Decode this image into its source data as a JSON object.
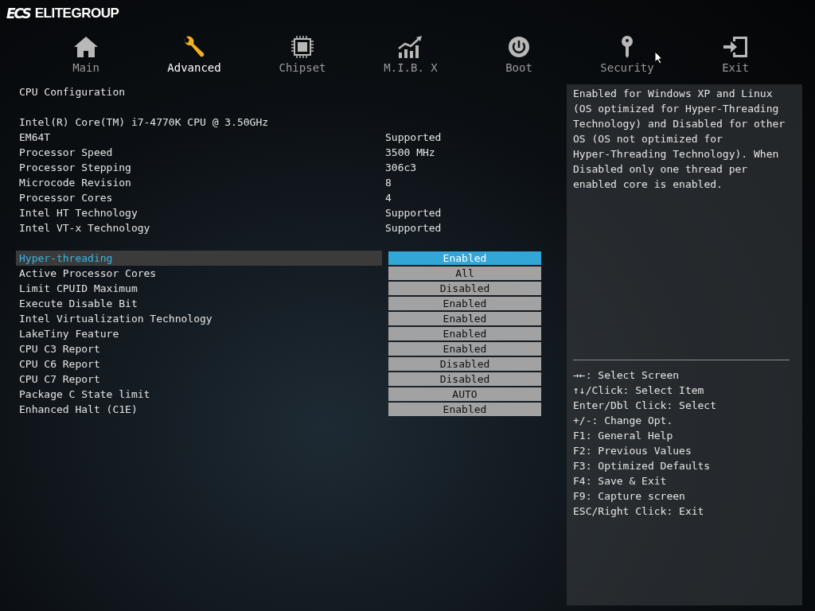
{
  "logo": {
    "mark": "ECS",
    "text": "ELITEGROUP"
  },
  "tabs": [
    {
      "label": "Main",
      "kind": "house",
      "selected": false
    },
    {
      "label": "Advanced",
      "kind": "wrench",
      "selected": true
    },
    {
      "label": "Chipset",
      "kind": "chip",
      "selected": false
    },
    {
      "label": "M.I.B. X",
      "kind": "chart",
      "selected": false
    },
    {
      "label": "Boot",
      "kind": "power",
      "selected": false
    },
    {
      "label": "Security",
      "kind": "key",
      "selected": false
    },
    {
      "label": "Exit",
      "kind": "exit",
      "selected": false
    }
  ],
  "section_title": "CPU Configuration",
  "processor_name": "Intel(R) Core(TM) i7-4770K CPU @ 3.50GHz",
  "info": [
    {
      "label": "EM64T",
      "value": "Supported"
    },
    {
      "label": "Processor Speed",
      "value": "3500 MHz"
    },
    {
      "label": "Processor Stepping",
      "value": "306c3"
    },
    {
      "label": "Microcode Revision",
      "value": "8"
    },
    {
      "label": "Processor Cores",
      "value": "4"
    },
    {
      "label": "Intel HT Technology",
      "value": "Supported"
    },
    {
      "label": "Intel VT-x Technology",
      "value": "Supported"
    }
  ],
  "settings": [
    {
      "label": "Hyper-threading",
      "value": "Enabled",
      "selected": true
    },
    {
      "label": "Active Processor Cores",
      "value": "All",
      "selected": false
    },
    {
      "label": "Limit CPUID Maximum",
      "value": "Disabled",
      "selected": false
    },
    {
      "label": "Execute Disable Bit",
      "value": "Enabled",
      "selected": false
    },
    {
      "label": "Intel Virtualization Technology",
      "value": "Enabled",
      "selected": false
    },
    {
      "label": "LakeTiny Feature",
      "value": "Enabled",
      "selected": false
    },
    {
      "label": "CPU C3 Report",
      "value": "Enabled",
      "selected": false
    },
    {
      "label": "CPU C6 Report",
      "value": "Disabled",
      "selected": false
    },
    {
      "label": "CPU C7 Report",
      "value": "Disabled",
      "selected": false
    },
    {
      "label": "Package C State limit",
      "value": "AUTO",
      "selected": false
    },
    {
      "label": "Enhanced Halt (C1E)",
      "value": "Enabled",
      "selected": false
    }
  ],
  "help": {
    "description": "Enabled for Windows XP and Linux (OS optimized for Hyper-Threading Technology) and Disabled for other OS (OS not optimized for Hyper-Threading Technology). When Disabled only one thread per enabled core is enabled.",
    "keys": [
      "→←: Select Screen",
      "↑↓/Click: Select Item",
      "Enter/Dbl Click: Select",
      "+/-: Change Opt.",
      "F1: General Help",
      "F2: Previous Values",
      "F3: Optimized Defaults",
      "F4: Save & Exit",
      "F9: Capture screen",
      "ESC/Right Click: Exit"
    ]
  }
}
